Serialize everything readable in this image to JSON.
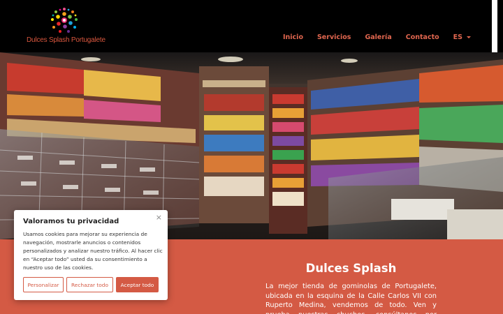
{
  "header": {
    "logo_text": "Dulces Splash Portugalete",
    "nav": [
      "Inicio",
      "Servicios",
      "Galería",
      "Contacto"
    ],
    "language": "ES"
  },
  "section": {
    "title": "Dulces Splash",
    "text": "La mejor tienda de gominolas de Portugalete, ubicada en la esquina de la Calle Carlos VII con Ruperto Medina, vendemos de todo. Ven y prueba nuestras chuches, consúltanos por nuestras bolsas de"
  },
  "cookie": {
    "title": "Valoramos tu privacidad",
    "text": "Usamos cookies para mejorar su experiencia de navegación, mostrarle anuncios o contenidos personalizados y analizar nuestro tráfico. Al hacer clic en “Aceptar todo” usted da su consentimiento a nuestro uso de las cookies.",
    "btn_customize": "Personalizar",
    "btn_reject": "Rechazar todo",
    "btn_accept": "Aceptar todo",
    "close": "×"
  },
  "colors": {
    "accent": "#d45a44",
    "nav": "#e0664f"
  }
}
